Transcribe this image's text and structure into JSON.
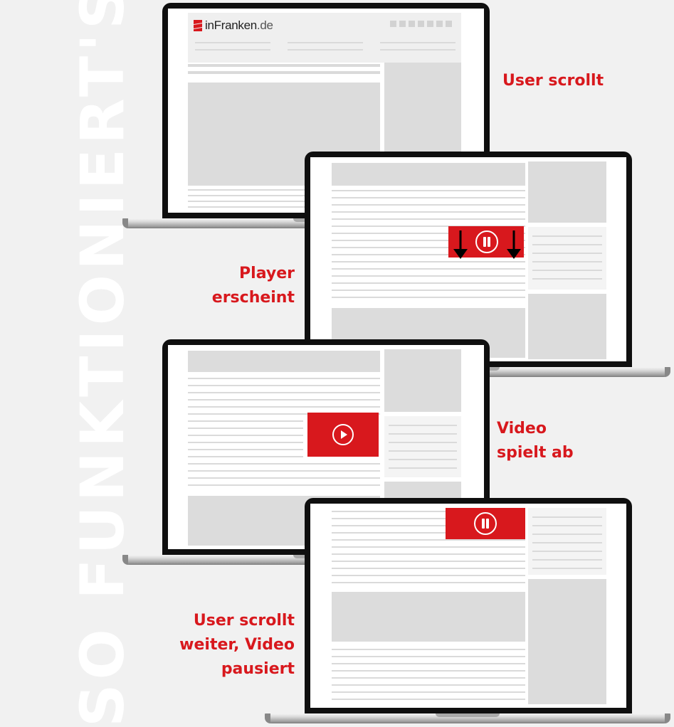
{
  "background_text": "SO FUNKTIONIERT'S",
  "logo": {
    "brand": "inFranken",
    "tld": ".de",
    "icon": "infranken-flag-icon"
  },
  "steps": [
    {
      "lines": [
        "User scrollt"
      ]
    },
    {
      "lines": [
        "Player",
        "erscheint"
      ]
    },
    {
      "lines": [
        "Video",
        "spielt ab"
      ]
    },
    {
      "lines": [
        "User scrollt",
        "weiter, Video",
        "pausiert"
      ]
    }
  ],
  "icons": {
    "arrow": "arrow-down-icon",
    "pause": "pause-icon",
    "play": "play-icon"
  },
  "colors": {
    "accent": "#d8181d",
    "background": "#f1f1f1",
    "placeholder_block": "#dcdcdc",
    "placeholder_line": "#dadada"
  }
}
